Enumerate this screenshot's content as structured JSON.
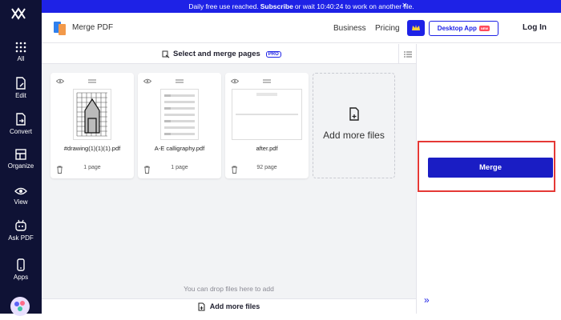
{
  "banner": {
    "prefix": "Daily free use reached.",
    "link": "Subscribe",
    "suffix": "or wait 10:40:24 to work on another file.",
    "close": "×"
  },
  "sidebar": {
    "items": [
      {
        "label": "All",
        "icon": "grid-icon"
      },
      {
        "label": "Edit",
        "icon": "edit-doc-icon"
      },
      {
        "label": "Convert",
        "icon": "convert-doc-icon"
      },
      {
        "label": "Organize",
        "icon": "layout-icon"
      },
      {
        "label": "View",
        "icon": "eye-icon"
      },
      {
        "label": "Ask PDF",
        "icon": "robot-icon"
      },
      {
        "label": "Apps",
        "icon": "phone-icon"
      }
    ]
  },
  "header": {
    "app_title": "Merge PDF",
    "nav": [
      "Business",
      "Pricing"
    ],
    "desktop_app": "Desktop App",
    "new_badge": "NEW",
    "login": "Log In"
  },
  "main": {
    "title": "Select and merge pages",
    "pro_badge": "PRO",
    "files": [
      {
        "name": "#drawing(1)(1)(1).pdf",
        "pages": "1 page"
      },
      {
        "name": "A-E calligraphy.pdf",
        "pages": "1 page"
      },
      {
        "name": "after.pdf",
        "pages": "92 page"
      }
    ],
    "add_more_label": "Add more files",
    "drop_text": "You can drop files here to add",
    "bottom_add": "Add more files"
  },
  "right": {
    "merge_label": "Merge",
    "expand": "»"
  },
  "colors": {
    "brand": "#1e22e6",
    "sidebar_bg": "#0f1235",
    "highlight": "#e53935"
  }
}
